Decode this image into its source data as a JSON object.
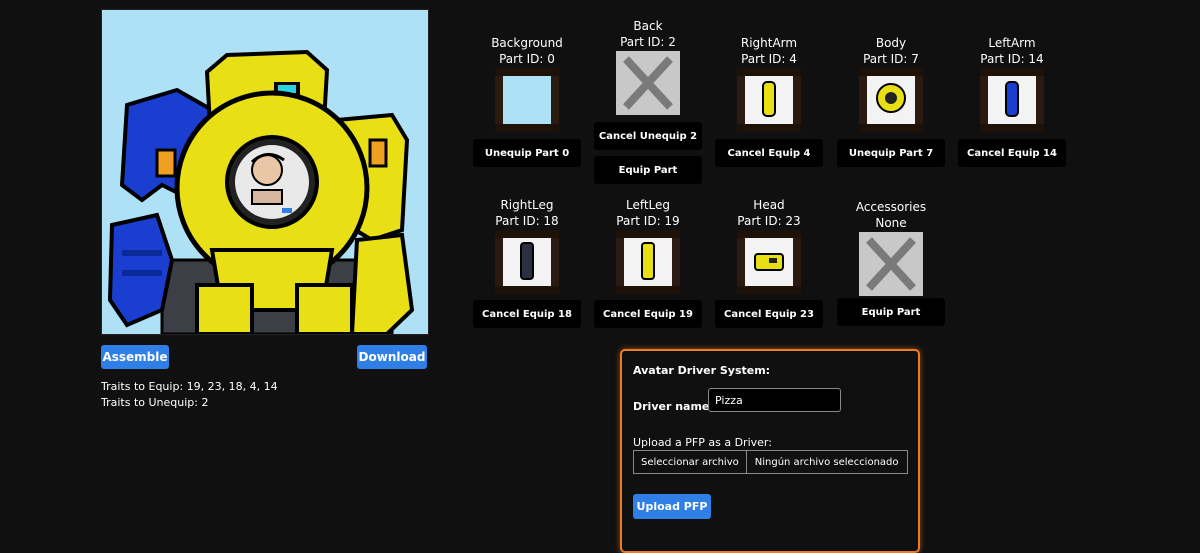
{
  "preview": {
    "alt": "robot avatar preview"
  },
  "actions": {
    "assemble": "Assemble",
    "download": "Download"
  },
  "traits": {
    "equip": "Traits to Equip: 19, 23, 18, 4, 14",
    "unequip": "Traits to Unequip: 2"
  },
  "parts": [
    {
      "name": "Background",
      "id_text": "Part ID: 0",
      "thumb": "background",
      "buttons": [
        "Unequip Part 0"
      ]
    },
    {
      "name": "Back",
      "id_text": "Part ID: 2",
      "thumb": "x",
      "buttons": [
        "Cancel Unequip 2",
        "Equip Part"
      ]
    },
    {
      "name": "RightArm",
      "id_text": "Part ID: 4",
      "thumb": "rightarm",
      "buttons": [
        "Cancel Equip 4"
      ]
    },
    {
      "name": "Body",
      "id_text": "Part ID: 7",
      "thumb": "body",
      "buttons": [
        "Unequip Part 7"
      ]
    },
    {
      "name": "LeftArm",
      "id_text": "Part ID: 14",
      "thumb": "leftarm",
      "buttons": [
        "Cancel Equip 14"
      ]
    },
    {
      "name": "RightLeg",
      "id_text": "Part ID: 18",
      "thumb": "rightleg",
      "buttons": [
        "Cancel Equip 18"
      ]
    },
    {
      "name": "LeftLeg",
      "id_text": "Part ID: 19",
      "thumb": "leftleg",
      "buttons": [
        "Cancel Equip 19"
      ]
    },
    {
      "name": "Head",
      "id_text": "Part ID: 23",
      "thumb": "head",
      "buttons": [
        "Cancel Equip 23"
      ]
    },
    {
      "name": "Accessories",
      "id_text": "None",
      "thumb": "x",
      "buttons": [
        "Equip Part"
      ]
    }
  ],
  "driver": {
    "title": "Avatar Driver System:",
    "name_label": "Driver name:",
    "name_value": "Pizza",
    "upload_label": "Upload a PFP as a Driver:",
    "file_button": "Seleccionar archivo",
    "file_status": "Ningún archivo seleccionado",
    "upload_button": "Upload PFP"
  },
  "colors": {
    "accent": "#2f7fe6",
    "panel_border": "#f07a22",
    "background": "#101010"
  }
}
